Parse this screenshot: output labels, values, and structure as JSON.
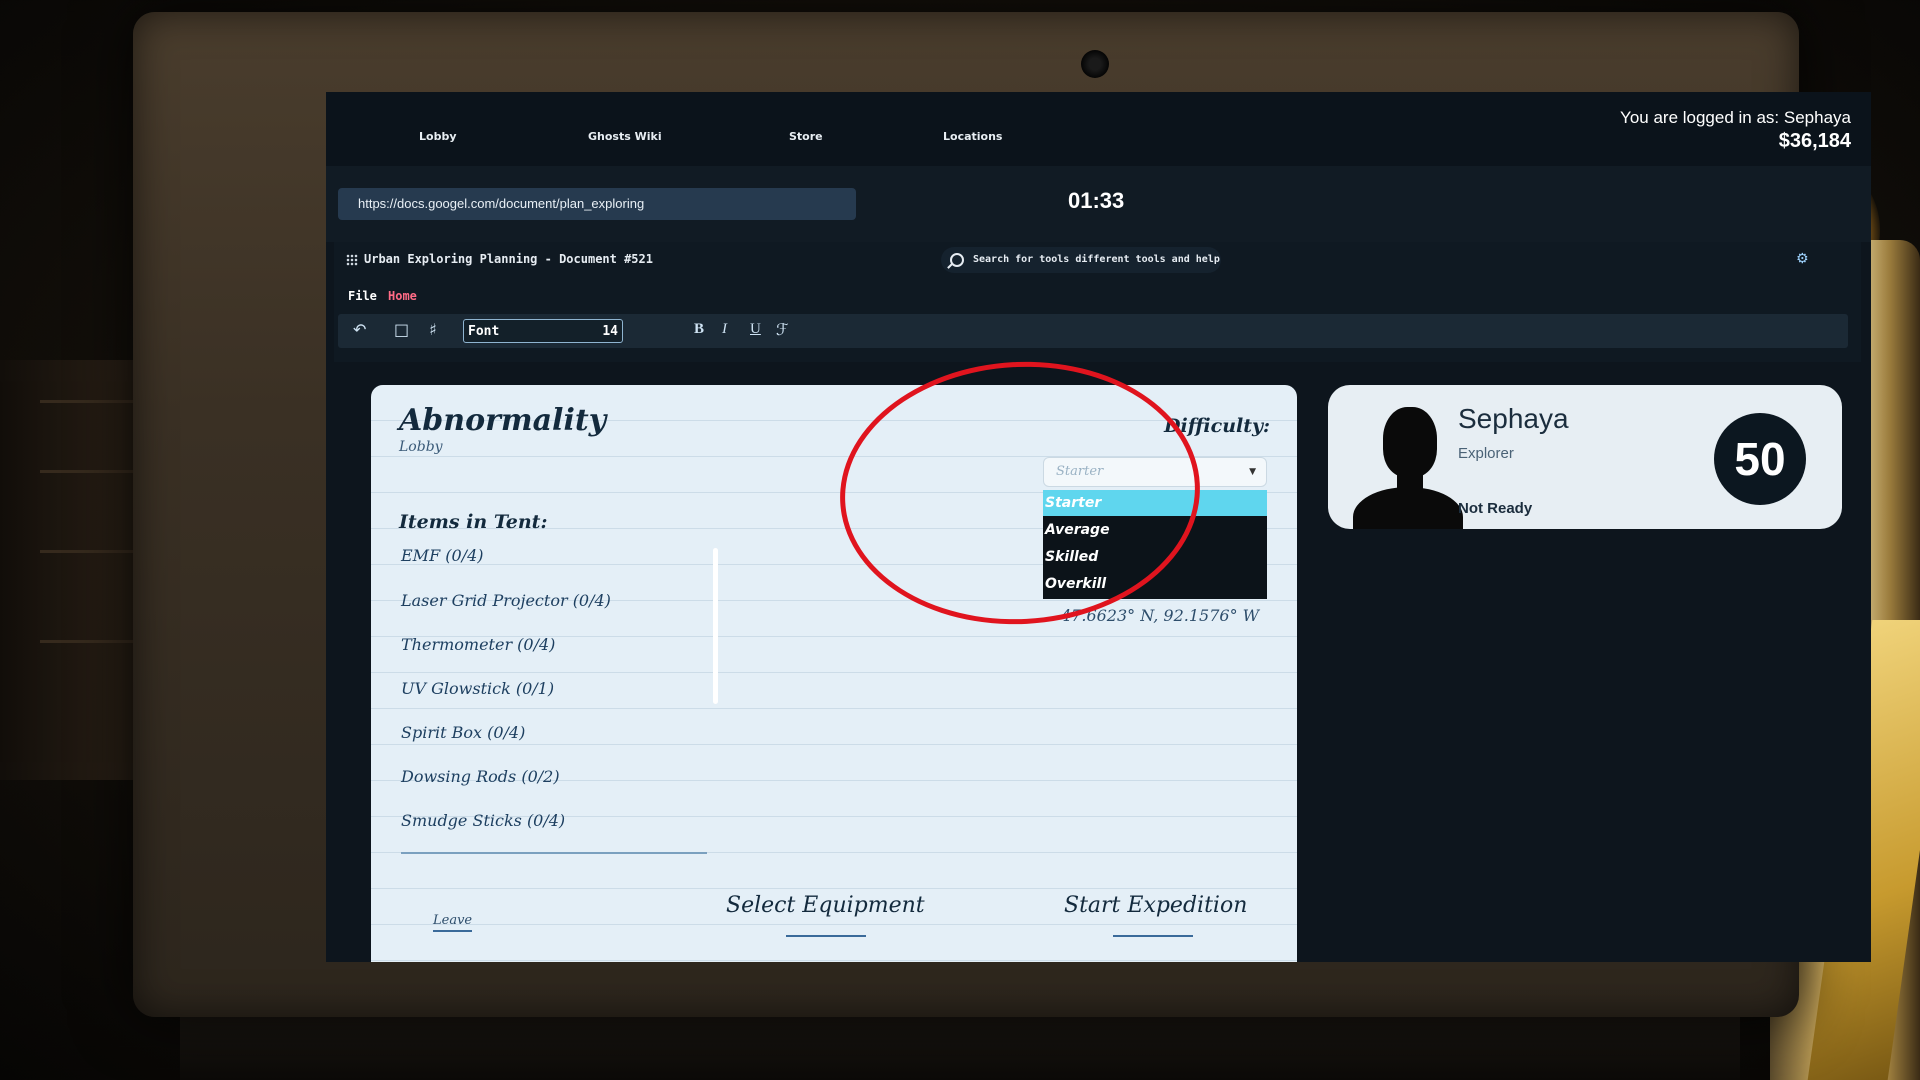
{
  "nav": {
    "tabs": [
      "Lobby",
      "Ghosts Wiki",
      "Store",
      "Locations"
    ],
    "logged_in_text": "You are logged in as: Sephaya",
    "money": "$36,184"
  },
  "browser": {
    "url": "https://docs.googel.com/document/plan_exploring",
    "timer": "01:33"
  },
  "document": {
    "title": "Urban Exploring Planning - Document #521",
    "search_placeholder": "Search for tools different tools and help",
    "menu_file": "File",
    "menu_home": "Home",
    "font_name": "Font",
    "font_size": "14",
    "format_bold": "B",
    "format_italic": "I",
    "format_underline": "U"
  },
  "lobby": {
    "name": "Abnormality",
    "subtitle": "Lobby",
    "items_heading": "Items in Tent:",
    "items": [
      "EMF (0/4)",
      "Laser Grid Projector (0/4)",
      "Thermometer (0/4)",
      "UV Glowstick (0/1)",
      "Spirit Box (0/4)",
      "Dowsing Rods (0/2)",
      "Smudge Sticks (0/4)"
    ],
    "difficulty_label": "Difficulty:",
    "difficulty_selected": "Starter",
    "difficulty_options": [
      "Starter",
      "Average",
      "Skilled",
      "Overkill"
    ],
    "coordinates": "47.6623° N, 92.1576° W",
    "leave_label": "Leave",
    "select_equipment_label": "Select Equipment",
    "start_expedition_label": "Start Expedition"
  },
  "player": {
    "name": "Sephaya",
    "role": "Explorer",
    "status": "Not Ready",
    "level": "50"
  },
  "colors": {
    "highlight": "#e0141e",
    "selected_option": "#5fd6ee",
    "home_menu": "#ff6b86"
  },
  "icons": [
    "undo-icon",
    "clipboard-icon",
    "paint-format-icon",
    "search-icon",
    "gear-icon",
    "grid-icon"
  ]
}
